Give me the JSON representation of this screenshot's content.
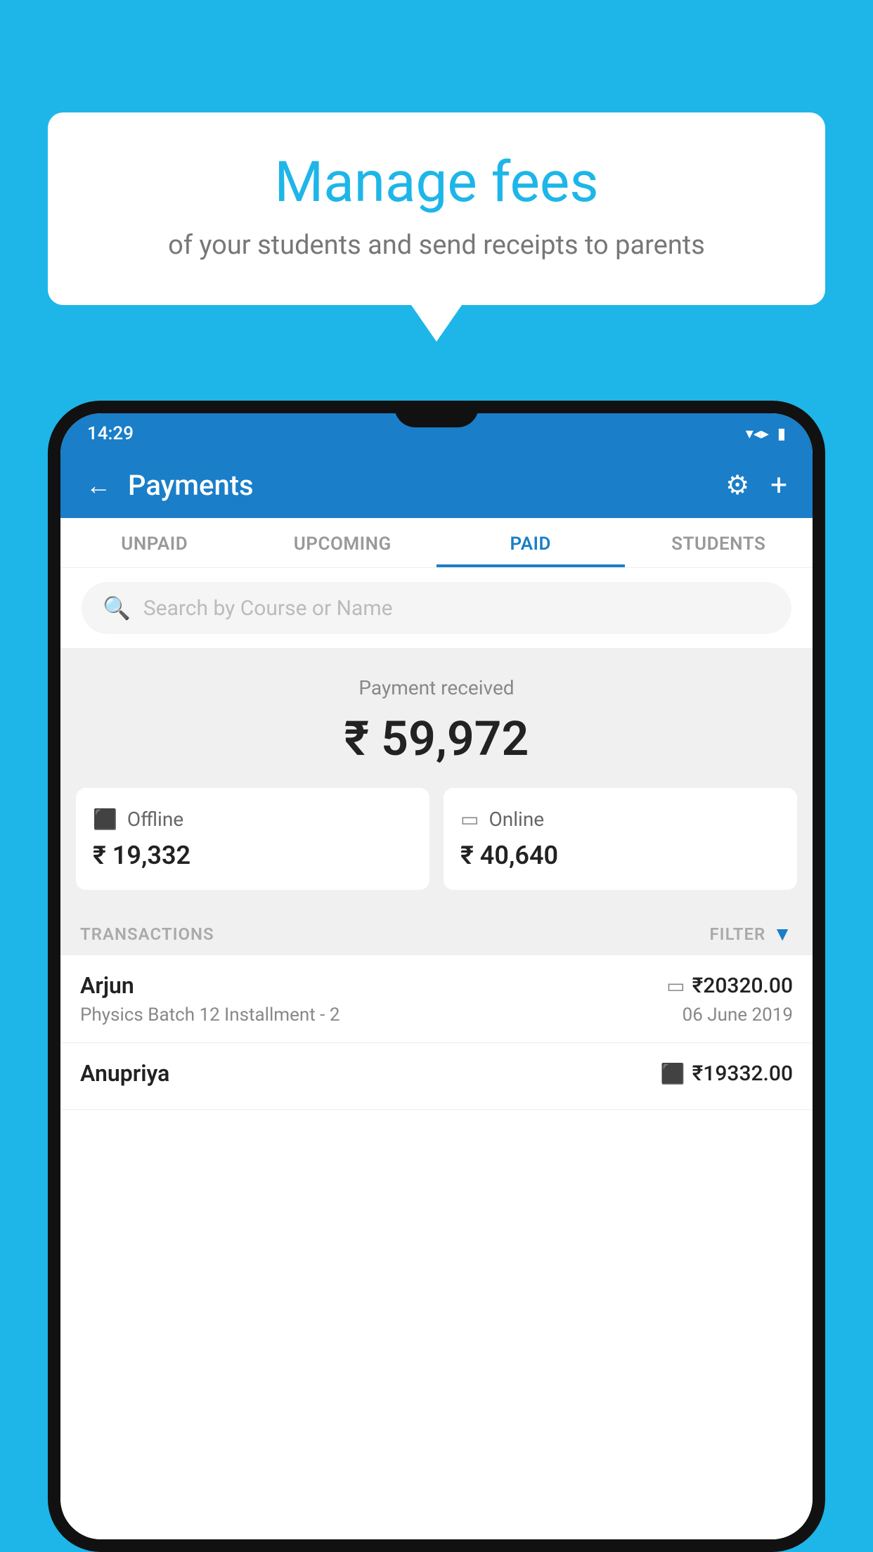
{
  "background_color": "#1eb6e8",
  "bubble": {
    "title": "Manage fees",
    "subtitle": "of your students and send receipts to parents"
  },
  "phone": {
    "status_bar": {
      "time": "14:29",
      "wifi": "▼",
      "signal": "▲",
      "battery": "▪"
    },
    "header": {
      "back_label": "←",
      "title": "Payments",
      "gear_label": "⚙",
      "plus_label": "+"
    },
    "tabs": [
      {
        "label": "UNPAID",
        "active": false
      },
      {
        "label": "UPCOMING",
        "active": false
      },
      {
        "label": "PAID",
        "active": true
      },
      {
        "label": "STUDENTS",
        "active": false
      }
    ],
    "search": {
      "placeholder": "Search by Course or Name"
    },
    "payment_summary": {
      "label": "Payment received",
      "amount": "₹ 59,972"
    },
    "payment_cards": [
      {
        "type": "Offline",
        "amount": "₹ 19,332",
        "icon": "💳"
      },
      {
        "type": "Online",
        "amount": "₹ 40,640",
        "icon": "💳"
      }
    ],
    "transactions": {
      "label": "TRANSACTIONS",
      "filter_label": "FILTER"
    },
    "transaction_list": [
      {
        "student_name": "Arjun",
        "course": "Physics Batch 12 Installment - 2",
        "amount": "₹20320.00",
        "date": "06 June 2019",
        "method": "online"
      },
      {
        "student_name": "Anupriya",
        "course": "",
        "amount": "₹19332.00",
        "date": "",
        "method": "offline"
      }
    ]
  }
}
